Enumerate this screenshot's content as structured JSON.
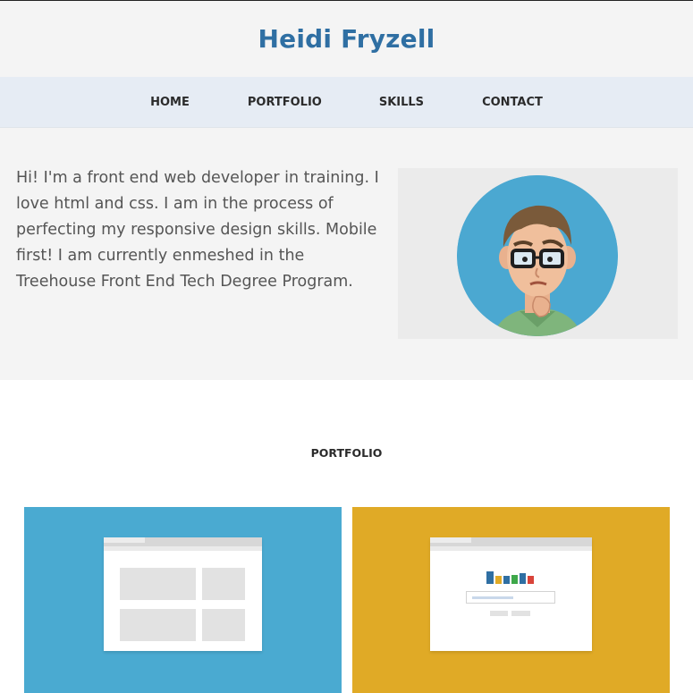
{
  "site": {
    "title": "Heidi Fryzell"
  },
  "nav": {
    "items": [
      {
        "label": "HOME"
      },
      {
        "label": "PORTFOLIO"
      },
      {
        "label": "SKILLS"
      },
      {
        "label": "CONTACT"
      }
    ]
  },
  "intro": {
    "text": "Hi! I'm a front end web developer in training. I love html and css. I am in the process of perfecting my responsive design skills. Mobile first! I am currently enmeshed in the Treehouse Front End Tech Degree Program.",
    "avatar_icon": "cartoon-avatar-icon"
  },
  "portfolio": {
    "heading": "PORTFOLIO",
    "projects": [
      {
        "color": "#4aaad1",
        "thumbnail_icon": "browser-grid-layout-icon"
      },
      {
        "color": "#e0aa26",
        "thumbnail_icon": "browser-search-layout-icon"
      }
    ]
  },
  "colors": {
    "title": "#2f6fa3",
    "header_bg": "#f4f4f4",
    "nav_bg": "#e6ecf4",
    "avatar_bg": "#4ba8d1",
    "logo_bars": [
      "#2f6fa3",
      "#e0aa26",
      "#2f6fa3",
      "#3ea84a",
      "#2f6fa3",
      "#d9443a"
    ]
  }
}
